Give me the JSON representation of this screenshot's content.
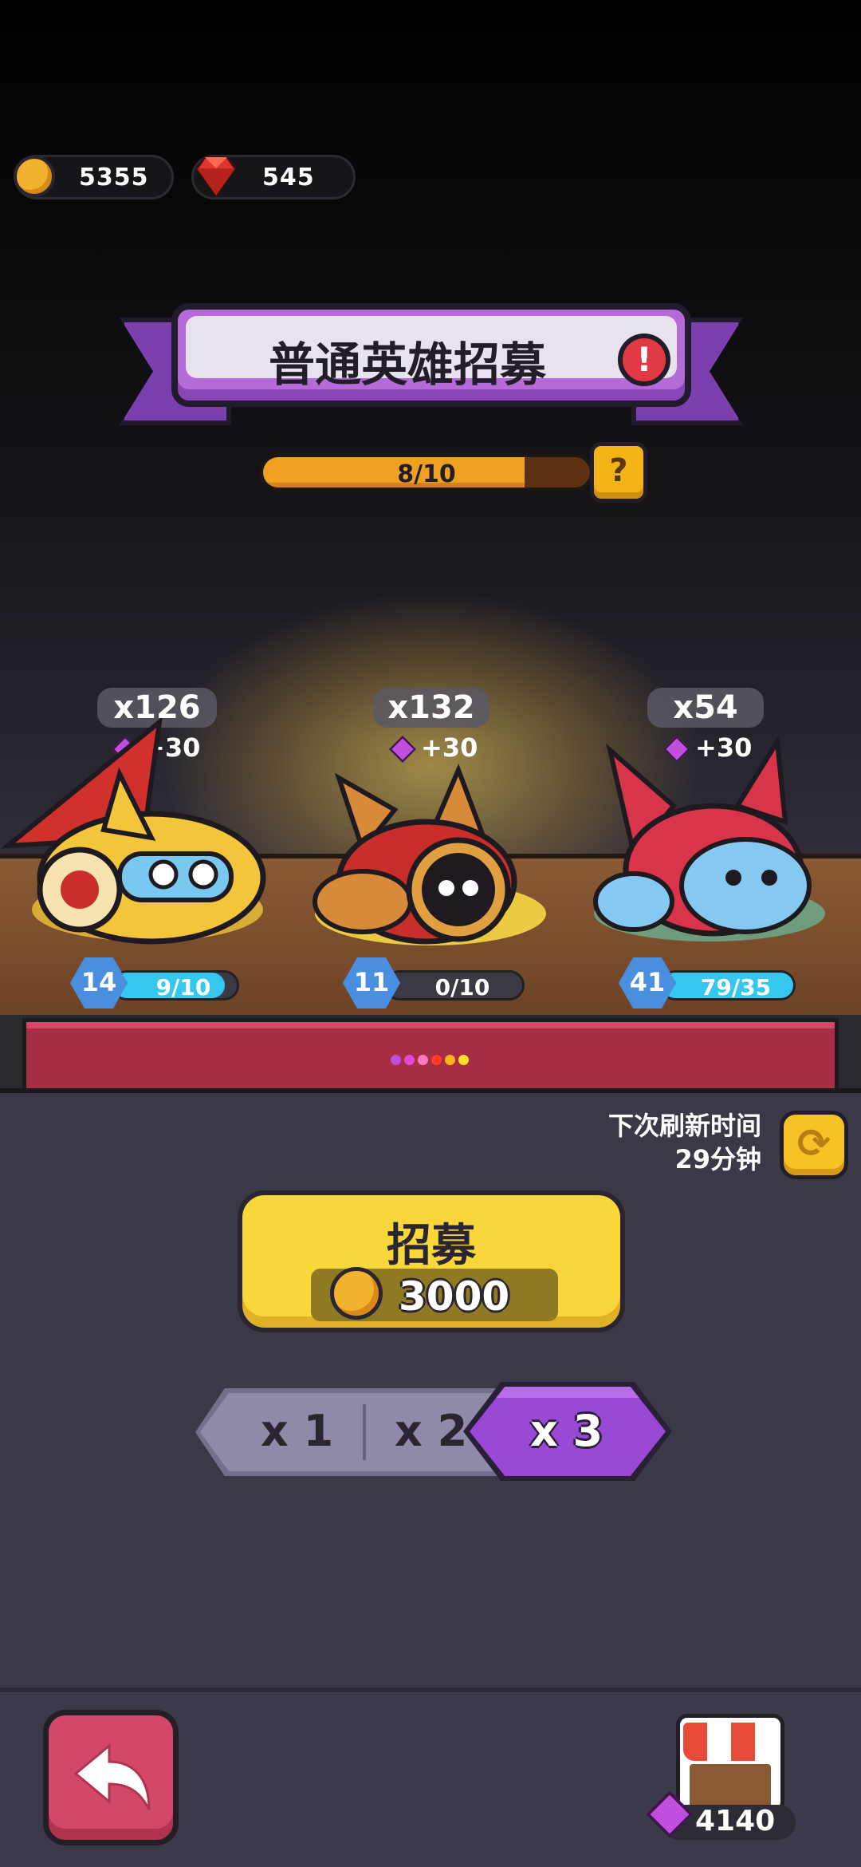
{
  "currency": {
    "coins": "5355",
    "gems": "545"
  },
  "banner": {
    "title": "普通英雄招募"
  },
  "progress": {
    "text": "8/10",
    "fraction": 0.8
  },
  "heroes": [
    {
      "count": "x126",
      "bonus": "+30",
      "level": "14",
      "shards": "9/10",
      "fill": 0.9
    },
    {
      "count": "x132",
      "bonus": "+30",
      "level": "11",
      "shards": "0/10",
      "fill": 0.0
    },
    {
      "count": "x54",
      "bonus": "+30",
      "level": "41",
      "shards": "79/35",
      "fill": 1.0
    }
  ],
  "refresh": {
    "label": "下次刷新时间",
    "time": "29分钟"
  },
  "recruit": {
    "label": "招募",
    "cost": "3000"
  },
  "multipliers": {
    "options": [
      "x 1",
      "x 2",
      "x 3"
    ],
    "selected": "x 3"
  },
  "shop": {
    "gems": "4140"
  },
  "colors": {
    "banner_purple": "#b46bd8",
    "recruit_yellow": "#f9d63a",
    "selected_purple": "#9a48d6",
    "back_red": "#d3476a"
  },
  "icons": [
    "coin-icon",
    "ruby-icon",
    "alert-icon",
    "help-icon",
    "refresh-icon",
    "back-arrow-icon",
    "shop-icon",
    "gem-icon"
  ]
}
